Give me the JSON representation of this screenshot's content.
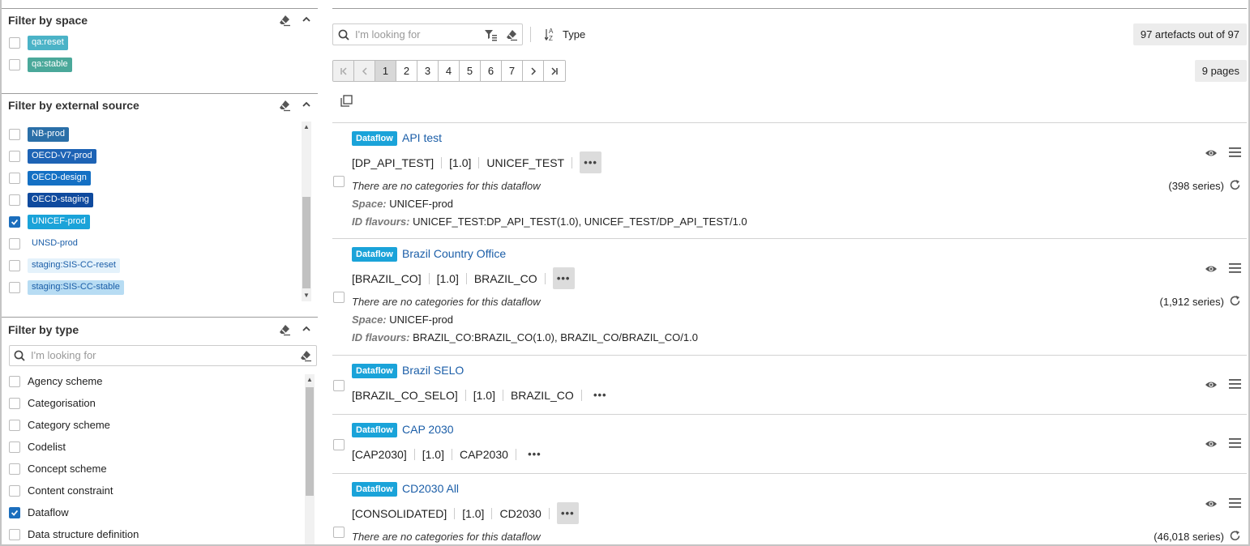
{
  "filters": {
    "space": {
      "title": "Filter by space",
      "items": [
        {
          "label": "qa:reset",
          "checked": false
        },
        {
          "label": "qa:stable",
          "checked": false
        }
      ]
    },
    "external": {
      "title": "Filter by external source",
      "items": [
        {
          "label": "NB-prod",
          "checked": false
        },
        {
          "label": "OECD-V7-prod",
          "checked": false
        },
        {
          "label": "OECD-design",
          "checked": false
        },
        {
          "label": "OECD-staging",
          "checked": false
        },
        {
          "label": "UNICEF-prod",
          "checked": true
        },
        {
          "label": "UNSD-prod",
          "checked": false
        },
        {
          "label": "staging:SIS-CC-reset",
          "checked": false
        },
        {
          "label": "staging:SIS-CC-stable",
          "checked": false
        }
      ]
    },
    "type": {
      "title": "Filter by type",
      "search_placeholder": "I'm looking for",
      "items": [
        {
          "label": "Agency scheme",
          "checked": false
        },
        {
          "label": "Categorisation",
          "checked": false
        },
        {
          "label": "Category scheme",
          "checked": false
        },
        {
          "label": "Codelist",
          "checked": false
        },
        {
          "label": "Concept scheme",
          "checked": false
        },
        {
          "label": "Content constraint",
          "checked": false
        },
        {
          "label": "Dataflow",
          "checked": true
        },
        {
          "label": "Data structure definition",
          "checked": false
        }
      ]
    }
  },
  "colors": {
    "tag_teal": "#4bb3c7",
    "tag_green": "#4aa89a",
    "tag_blue": "#1b6ebd",
    "accent": "#1aa3d9"
  },
  "toolbar": {
    "search_placeholder": "I'm looking for",
    "type_label": "Type",
    "count_label": "97 artefacts out of 97",
    "pages_label": "9 pages"
  },
  "pager": {
    "first": "‹‹",
    "prev": "‹",
    "pages": [
      "1",
      "2",
      "3",
      "4",
      "5",
      "6",
      "7"
    ],
    "next": "›",
    "last": "›|",
    "current": "1"
  },
  "results": [
    {
      "badge": "Dataflow",
      "title": "API test",
      "id": "[DP_API_TEST]",
      "version": "[1.0]",
      "agency": "UNICEF_TEST",
      "categories": "There are no categories for this dataflow",
      "space_label": "Space:",
      "space": "UNICEF-prod",
      "flavours_label": "ID flavours:",
      "flavours": "UNICEF_TEST:DP_API_TEST(1.0), UNICEF_TEST/DP_API_TEST/1.0",
      "series": "(398 series)"
    },
    {
      "badge": "Dataflow",
      "title": "Brazil Country Office",
      "id": "[BRAZIL_CO]",
      "version": "[1.0]",
      "agency": "BRAZIL_CO",
      "categories": "There are no categories for this dataflow",
      "space_label": "Space:",
      "space": "UNICEF-prod",
      "flavours_label": "ID flavours:",
      "flavours": "BRAZIL_CO:BRAZIL_CO(1.0), BRAZIL_CO/BRAZIL_CO/1.0",
      "series": "(1,912 series)"
    },
    {
      "badge": "Dataflow",
      "title": "Brazil SELO",
      "id": "[BRAZIL_CO_SELO]",
      "version": "[1.0]",
      "agency": "BRAZIL_CO"
    },
    {
      "badge": "Dataflow",
      "title": "CAP 2030",
      "id": "[CAP2030]",
      "version": "[1.0]",
      "agency": "CAP2030"
    },
    {
      "badge": "Dataflow",
      "title": "CD2030 All",
      "id": "[CONSOLIDATED]",
      "version": "[1.0]",
      "agency": "CD2030",
      "categories": "There are no categories for this dataflow",
      "series": "(46,018 series)"
    }
  ]
}
